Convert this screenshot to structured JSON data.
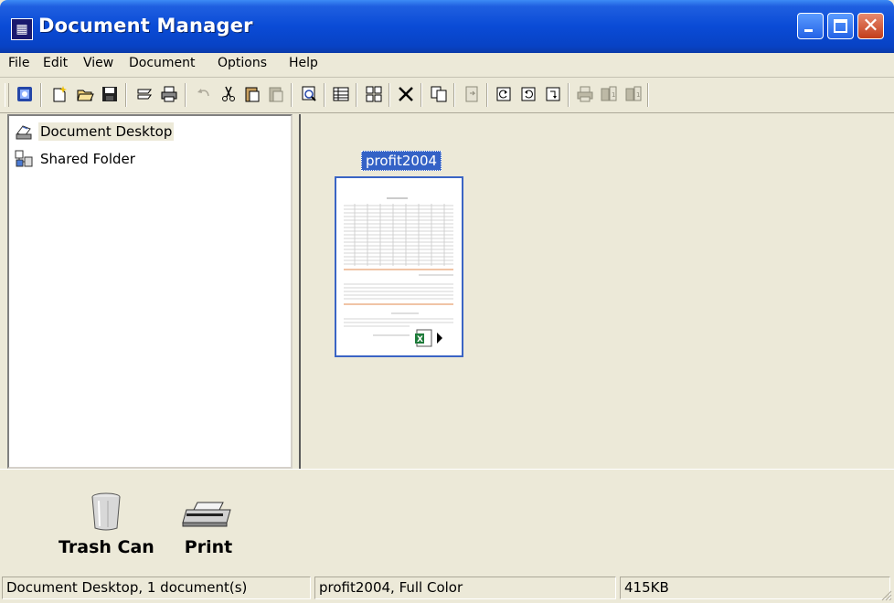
{
  "window": {
    "title": "Document Manager"
  },
  "menu": [
    "File",
    "Edit",
    "View",
    "Document",
    "Options",
    "Help"
  ],
  "tree": [
    {
      "label": "Document Desktop",
      "icon": "desktop-icon"
    },
    {
      "label": "Shared Folder",
      "icon": "shared-folder-icon"
    }
  ],
  "document": {
    "name": "profit2004",
    "file_type_icon": "excel-icon"
  },
  "bottom": {
    "trash": "Trash Can",
    "print": "Print"
  },
  "status": {
    "location": "Document Desktop, 1 document(s)",
    "selection": "profit2004, Full Color",
    "size": "415KB"
  }
}
